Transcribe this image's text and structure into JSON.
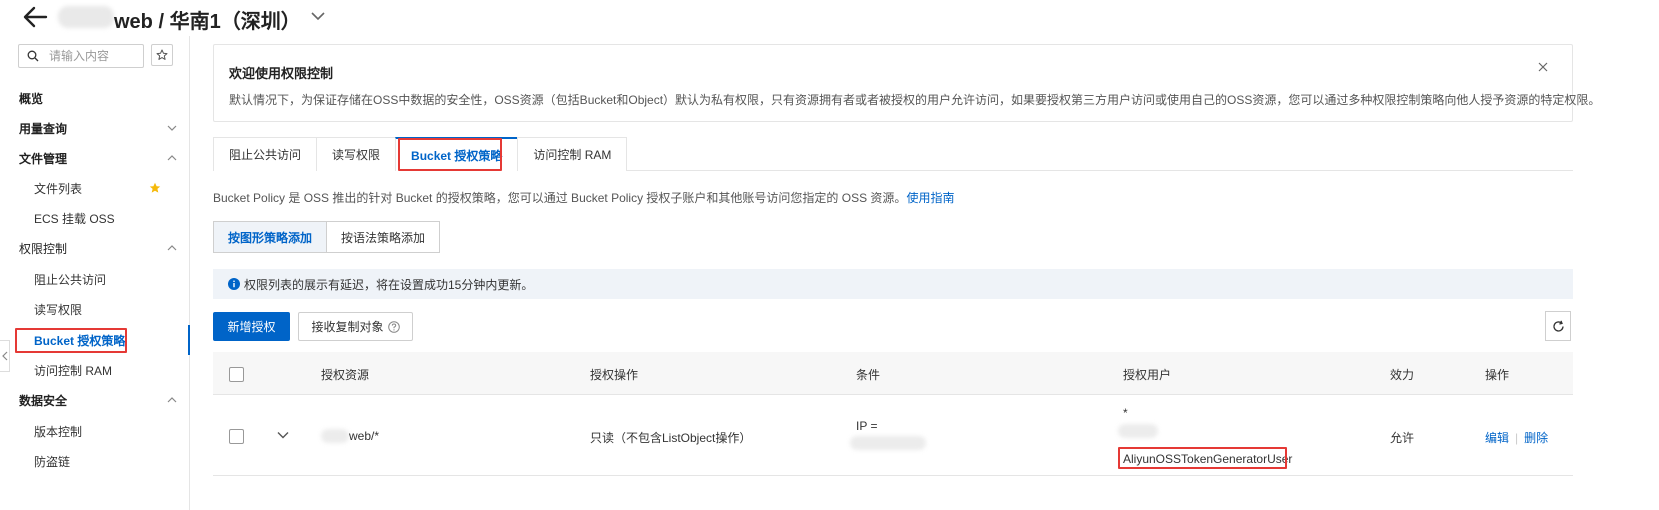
{
  "header": {
    "title": "web / 华南1（深圳）"
  },
  "sidebar": {
    "search_placeholder": "请输入内容",
    "items": [
      {
        "label": "概览"
      },
      {
        "label": "用量查询"
      },
      {
        "label": "文件管理"
      },
      {
        "label": "文件列表"
      },
      {
        "label": "ECS 挂载 OSS"
      },
      {
        "label": "权限控制"
      },
      {
        "label": "阻止公共访问"
      },
      {
        "label": "读写权限"
      },
      {
        "label": "Bucket 授权策略"
      },
      {
        "label": "访问控制 RAM"
      },
      {
        "label": "数据安全"
      },
      {
        "label": "版本控制"
      },
      {
        "label": "防盗链"
      }
    ]
  },
  "notice": {
    "title": "欢迎使用权限控制",
    "body": "默认情况下，为保证存储在OSS中数据的安全性，OSS资源（包括Bucket和Object）默认为私有权限，只有资源拥有者或者被授权的用户允许访问，如果要授权第三方用户访问或使用自己的OSS资源，您可以通过多种权限控制策略向他人授予资源的特定权限。"
  },
  "tabs": [
    {
      "label": "阻止公共访问"
    },
    {
      "label": "读写权限"
    },
    {
      "label": "Bucket 授权策略"
    },
    {
      "label": "访问控制 RAM"
    }
  ],
  "policy": {
    "description": "Bucket Policy 是 OSS 推出的针对 Bucket 的授权策略，您可以通过 Bucket Policy 授权子账户和其他账号访问您指定的 OSS 资源。",
    "guide_link": "使用指南",
    "mode_graphic": "按图形策略添加",
    "mode_syntax": "按语法策略添加"
  },
  "info_bar": {
    "text": "权限列表的展示有延迟，将在设置成功15分钟内更新。"
  },
  "toolbar": {
    "add_label": "新增授权",
    "receive_label": "接收复制对象"
  },
  "table": {
    "headers": [
      "授权资源",
      "授权操作",
      "条件",
      "授权用户",
      "效力",
      "操作"
    ],
    "rows": [
      {
        "resource": "web/*",
        "action": "只读（不包含ListObject操作）",
        "condition": "IP =",
        "user_star": "*",
        "user_name": "AliyunOSSTokenGeneratorUser",
        "effect": "允许",
        "edit": "编辑",
        "delete": "删除"
      }
    ]
  },
  "colors": {
    "accent": "#0064c8",
    "highlight": "#e53935"
  }
}
